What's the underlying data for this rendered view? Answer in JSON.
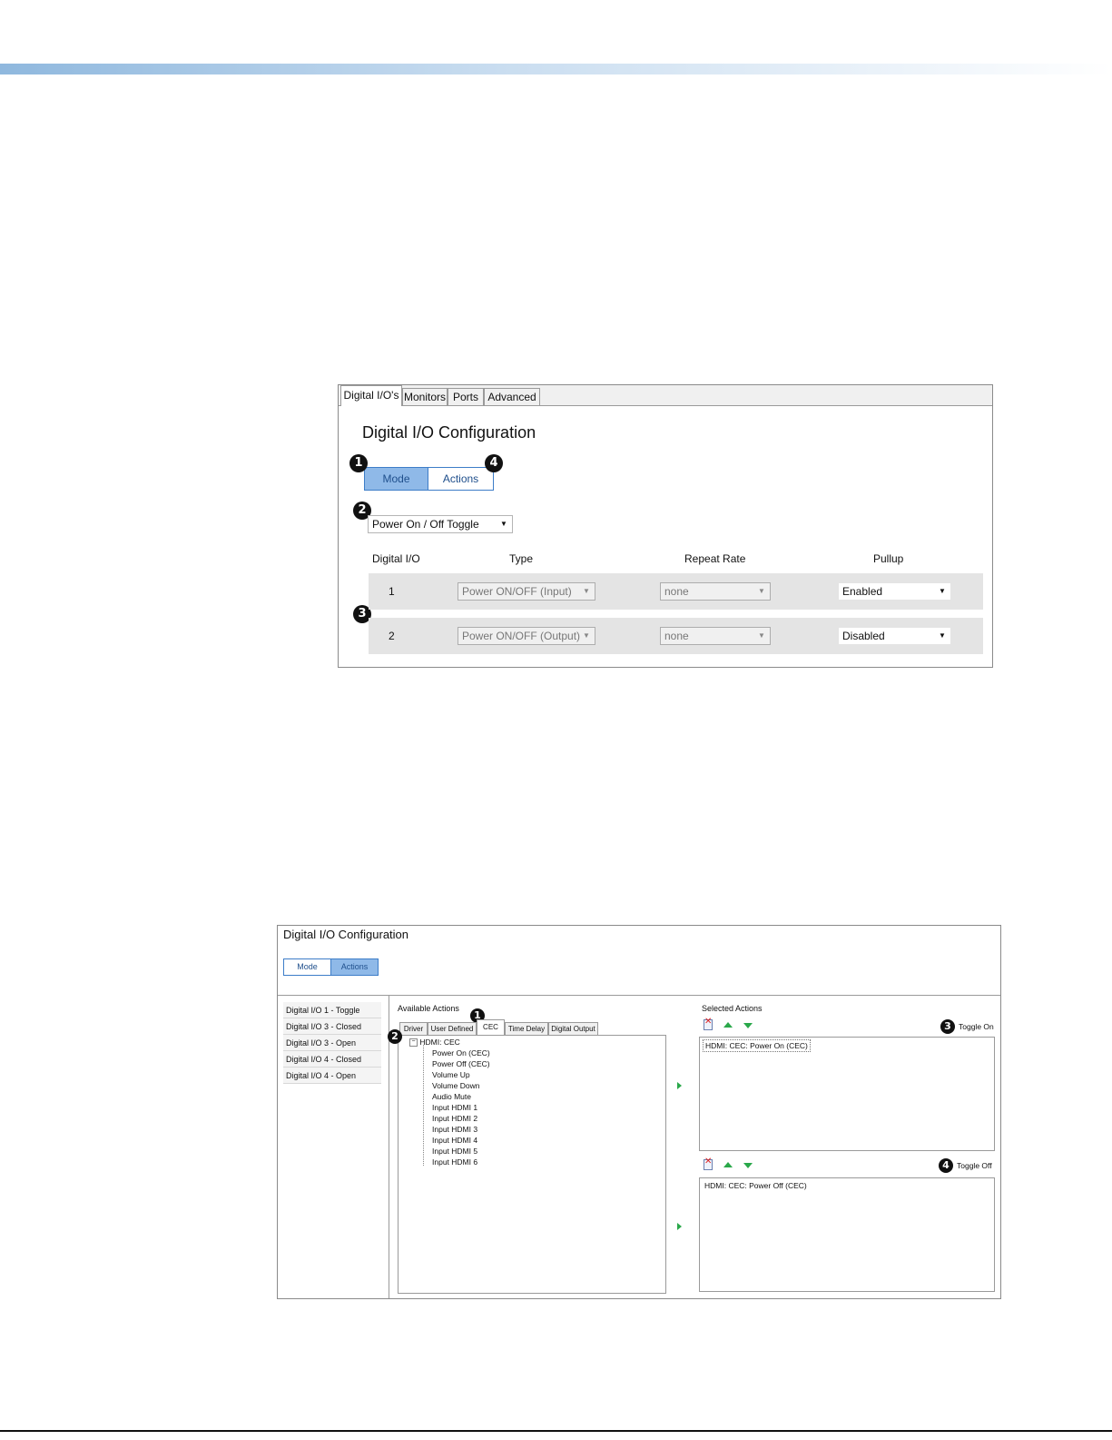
{
  "panel1": {
    "tabs": [
      "Digital I/O's",
      "Monitors",
      "Ports",
      "Advanced"
    ],
    "title": "Digital I/O Configuration",
    "mode_button": "Mode",
    "actions_button": "Actions",
    "mode_select": "Power On / Off Toggle",
    "headers": {
      "io": "Digital I/O",
      "type": "Type",
      "repeat": "Repeat Rate",
      "pullup": "Pullup"
    },
    "rows": [
      {
        "io": "1",
        "type": "Power ON/OFF (Input)",
        "repeat": "none",
        "pullup": "Enabled"
      },
      {
        "io": "2",
        "type": "Power ON/OFF (Output)",
        "repeat": "none",
        "pullup": "Disabled"
      }
    ],
    "callouts": {
      "b1": "1",
      "b2": "2",
      "b3": "3",
      "b4": "4"
    }
  },
  "panel2": {
    "title": "Digital I/O Configuration",
    "mode_button": "Mode",
    "actions_button": "Actions",
    "io_list": [
      "Digital I/O 1 - Toggle",
      "Digital I/O 3 - Closed",
      "Digital I/O 3 - Open",
      "Digital I/O 4 - Closed",
      "Digital I/O 4 - Open"
    ],
    "available_label": "Available Actions",
    "action_tabs": [
      "Driver",
      "User Defined",
      "CEC",
      "Time Delay",
      "Digital Output"
    ],
    "tree_root": "HDMI: CEC",
    "tree_items": [
      "Power On (CEC)",
      "Power Off (CEC)",
      "Volume Up",
      "Volume Down",
      "Audio Mute",
      "Input HDMI 1",
      "Input HDMI 2",
      "Input HDMI 3",
      "Input HDMI 4",
      "Input HDMI 5",
      "Input HDMI 6"
    ],
    "selected_label": "Selected Actions",
    "toggle_on_label": "Toggle On",
    "toggle_off_label": "Toggle Off",
    "toggle_on_items": [
      "HDMI: CEC: Power On (CEC)"
    ],
    "toggle_off_items": [
      "HDMI: CEC: Power Off (CEC)"
    ],
    "callouts": {
      "b1": "1",
      "b2": "2",
      "b3": "3",
      "b4": "4"
    }
  }
}
